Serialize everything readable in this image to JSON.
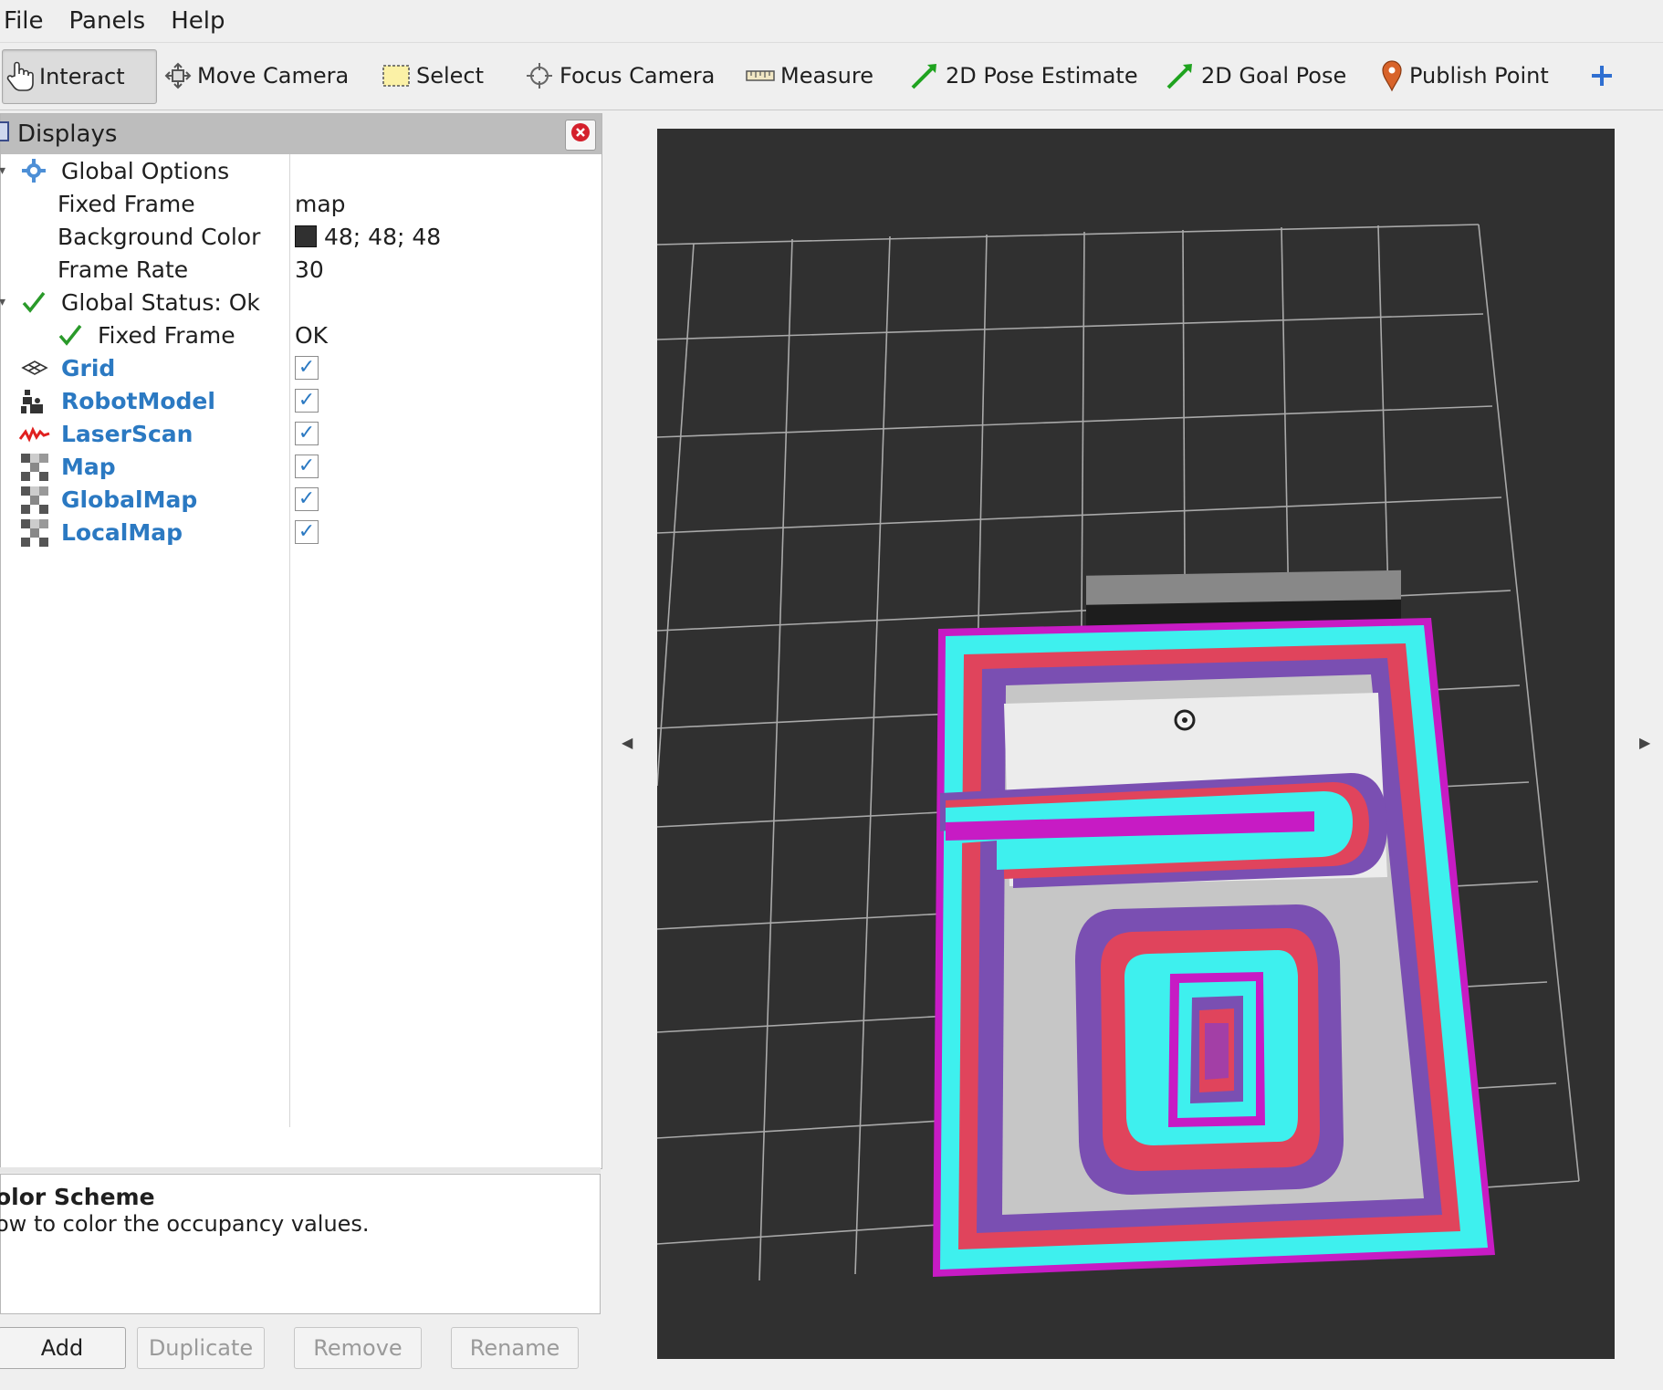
{
  "menu": {
    "file": "File",
    "panels": "Panels",
    "help": "Help"
  },
  "toolbar": {
    "interact": "Interact",
    "move_camera": "Move Camera",
    "select": "Select",
    "focus_camera": "Focus Camera",
    "measure": "Measure",
    "pose_estimate": "2D Pose Estimate",
    "goal_pose": "2D Goal Pose",
    "publish_point": "Publish Point"
  },
  "displays": {
    "title": "Displays",
    "global_options": {
      "label": "Global Options",
      "fixed_frame_label": "Fixed Frame",
      "fixed_frame_value": "map",
      "background_color_label": "Background Color",
      "background_color_value": "48; 48; 48",
      "background_color_hex": "#303030",
      "frame_rate_label": "Frame Rate",
      "frame_rate_value": "30"
    },
    "global_status": {
      "label": "Global Status: Ok",
      "fixed_frame_label": "Fixed Frame",
      "fixed_frame_value": "OK"
    },
    "items": [
      {
        "label": "Grid",
        "icon": "grid-icon",
        "enabled": true
      },
      {
        "label": "RobotModel",
        "icon": "robot-model-icon",
        "enabled": true
      },
      {
        "label": "LaserScan",
        "icon": "laser-scan-icon",
        "enabled": true
      },
      {
        "label": "Map",
        "icon": "map-icon",
        "enabled": true
      },
      {
        "label": "GlobalMap",
        "icon": "map-icon",
        "enabled": true
      },
      {
        "label": "LocalMap",
        "icon": "map-icon",
        "enabled": true
      }
    ]
  },
  "description": {
    "title": "olor Scheme",
    "text": "ow to color the occupancy values."
  },
  "buttons": {
    "add": "Add",
    "duplicate": "Duplicate",
    "remove": "Remove",
    "rename": "Rename"
  },
  "colors": {
    "accent_blue": "#2b79c2",
    "viewport_bg": "#303030",
    "costmap_cyan": "#3ef0ee",
    "costmap_magenta": "#c71bc4",
    "costmap_red": "#e0445c",
    "costmap_purple": "#7a4fb2"
  }
}
